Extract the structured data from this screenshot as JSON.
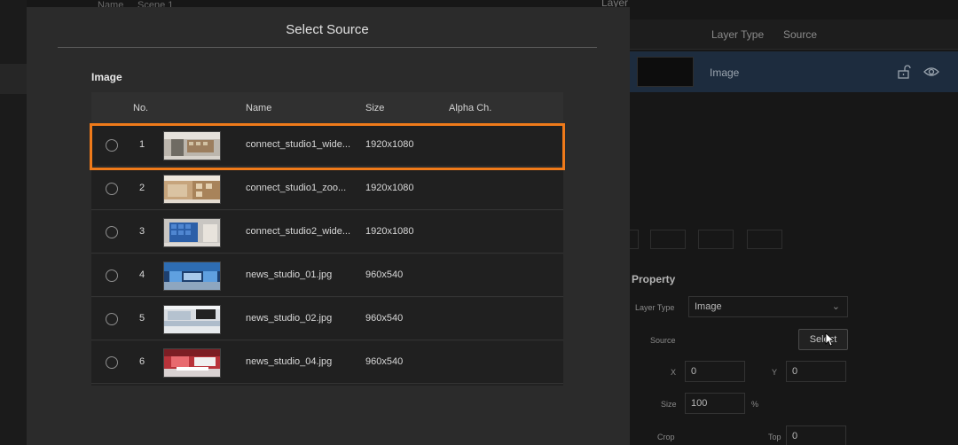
{
  "background": {
    "top_left_text": "Name",
    "top_left_text2": "Scene 1",
    "layer_panel_title": "Layer",
    "layer_columns": [
      "Layer Type",
      "Source"
    ],
    "layer_row": {
      "type": "Image"
    },
    "property": {
      "title": "Property",
      "layer_type_label": "Layer Type",
      "layer_type_value": "Image",
      "source_label": "Source",
      "select_label": "Select",
      "x_label": "X",
      "x_value": "0",
      "y_label": "Y",
      "y_value": "0",
      "size_label": "Size",
      "size_value": "100",
      "size_unit": "%",
      "crop_label": "Crop",
      "top_label": "Top",
      "top_value": "0"
    }
  },
  "modal": {
    "title": "Select Source",
    "section": "Image",
    "columns": {
      "no": "No.",
      "name": "Name",
      "size": "Size",
      "alpha": "Alpha Ch."
    },
    "rows": [
      {
        "no": "1",
        "name": "connect_studio1_wide...",
        "size": "1920x1080",
        "thumb": "studio-wide"
      },
      {
        "no": "2",
        "name": "connect_studio1_zoo...",
        "size": "1920x1080",
        "thumb": "studio-zoom"
      },
      {
        "no": "3",
        "name": "connect_studio2_wide...",
        "size": "1920x1080",
        "thumb": "studio-screens"
      },
      {
        "no": "4",
        "name": "news_studio_01.jpg",
        "size": "960x540",
        "thumb": "news-blue"
      },
      {
        "no": "5",
        "name": "news_studio_02.jpg",
        "size": "960x540",
        "thumb": "news-white"
      },
      {
        "no": "6",
        "name": "news_studio_04.jpg",
        "size": "960x540",
        "thumb": "news-red"
      }
    ],
    "highlight_color": "#ef7a1a"
  }
}
